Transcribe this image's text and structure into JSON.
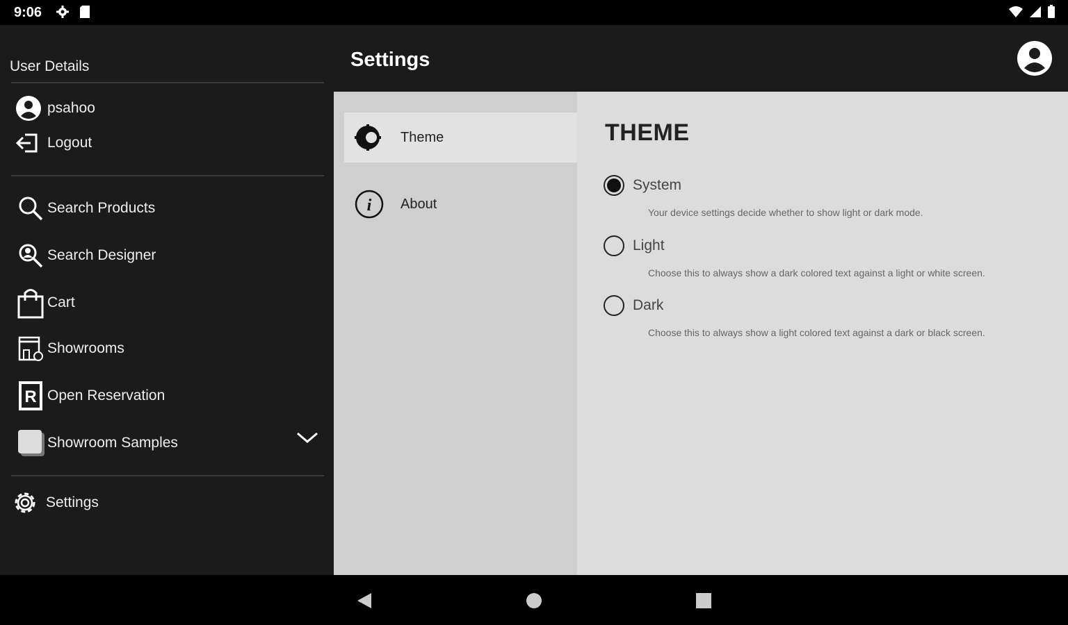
{
  "status_bar": {
    "time": "9:06",
    "icons": [
      "gear-icon",
      "sd-card-icon",
      "wifi-icon",
      "signal-icon",
      "battery-icon"
    ]
  },
  "drawer": {
    "section_title": "User Details",
    "username": "psahoo",
    "logout_label": "Logout",
    "menu": [
      {
        "label": "Search Products",
        "icon": "search-icon"
      },
      {
        "label": "Search Designer",
        "icon": "search-person-icon"
      },
      {
        "label": "Cart",
        "icon": "shopping-bag-icon"
      },
      {
        "label": "Showrooms",
        "icon": "store-icon"
      },
      {
        "label": "Open Reservation",
        "icon": "reservation-r-icon"
      },
      {
        "label": "Showroom Samples",
        "icon": "samples-icon"
      }
    ],
    "settings_label": "Settings"
  },
  "appbar": {
    "title": "Settings",
    "account_icon": "account-circle-icon"
  },
  "settings_nav": {
    "items": [
      {
        "label": "Theme",
        "icon": "theme-icon",
        "active": true
      },
      {
        "label": "About",
        "icon": "info-icon",
        "active": false
      }
    ]
  },
  "theme_panel": {
    "heading": "THEME",
    "selected": "System",
    "options": [
      {
        "label": "System",
        "description": "Your device settings decide whether to show light or dark mode."
      },
      {
        "label": "Light",
        "description": "Choose this to always show a dark colored text against a light or white screen."
      },
      {
        "label": "Dark",
        "description": "Choose this to always show a light colored text against a dark or black screen."
      }
    ]
  },
  "nav_bar": {
    "buttons": [
      "back-icon",
      "home-icon",
      "recents-icon"
    ]
  }
}
